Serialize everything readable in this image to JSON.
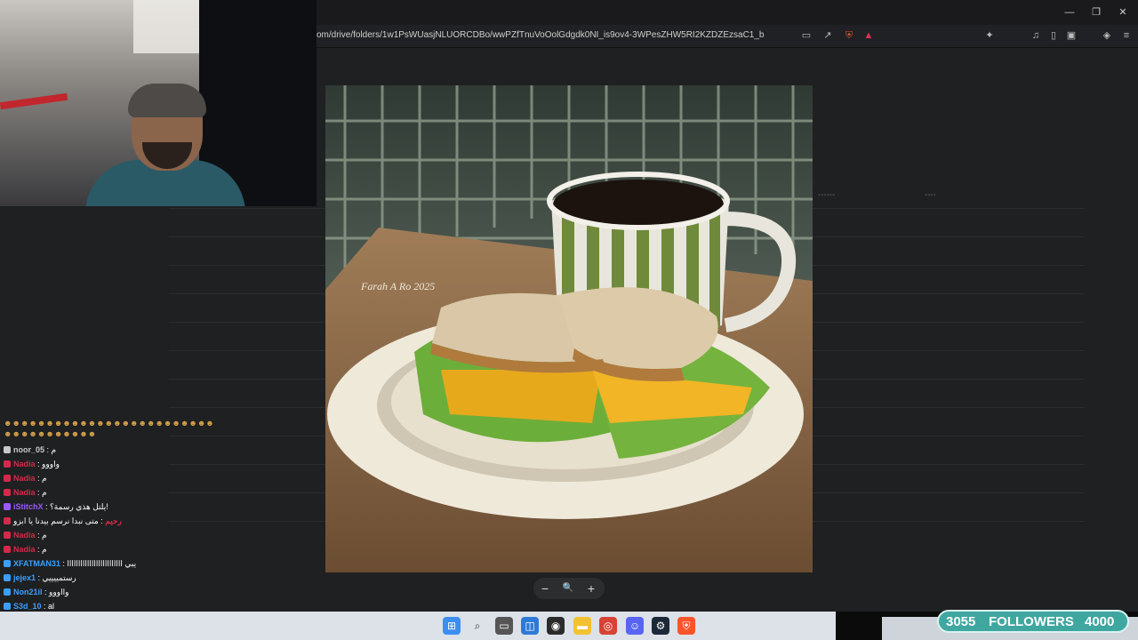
{
  "browser": {
    "url": "om/drive/folders/1w1PsWUasjNLUORCDBo/wwPZfTnuVoOolGdgdk0NI_is9ov4-3WPesZHW5RI2KZDZEzsaC1_b"
  },
  "chat": {
    "messages": [
      {
        "user": "noor_05",
        "text": "م",
        "color": "#c8c8c8"
      },
      {
        "user": "Nadia",
        "text": "واووو",
        "color": "#d6284a"
      },
      {
        "user": "Nadia",
        "text": "م",
        "color": "#d6284a"
      },
      {
        "user": "Nadia",
        "text": "م",
        "color": "#d6284a"
      },
      {
        "user": "iStitchX",
        "text": "يلتل هذي رسمة؟!",
        "color": "#9b59ff"
      },
      {
        "user": "رحيم",
        "text": "متى نبدا نرسم بيدنا يا ابزو",
        "color": "#d6284a"
      },
      {
        "user": "Nadia",
        "text": "م",
        "color": "#d6284a"
      },
      {
        "user": "Nadia",
        "text": "م",
        "color": "#d6284a"
      },
      {
        "user": "XFATMAN31",
        "text": "يبي ااااااااااااااااااااااااا",
        "color": "#3aa0ff"
      },
      {
        "user": "jejex1",
        "text": "رستمييييي",
        "color": "#3aa0ff"
      },
      {
        "user": "Non21il",
        "text": "وااووو",
        "color": "#3aa0ff"
      },
      {
        "user": "S3d_10",
        "text": "al",
        "color": "#3aa0ff"
      }
    ]
  },
  "viewer": {
    "artwork_signature": "Farah A Ro 2025",
    "zoom_out_label": "−",
    "zoom_icon_label": "🔍",
    "zoom_in_label": "+"
  },
  "overlay": {
    "followers_count": "3055",
    "followers_label": "FOLLOWERS",
    "followers_goal": "4000"
  },
  "taskbar": {
    "icons": [
      "windows-start-icon",
      "search-icon",
      "task-view-icon",
      "store-icon",
      "obs-icon",
      "file-explorer-icon",
      "chrome-icon",
      "discord-icon",
      "steam-icon",
      "brave-icon"
    ]
  },
  "colors": {
    "follower_bar": "#3fa7a0",
    "taskbar": "#dde1e8"
  }
}
